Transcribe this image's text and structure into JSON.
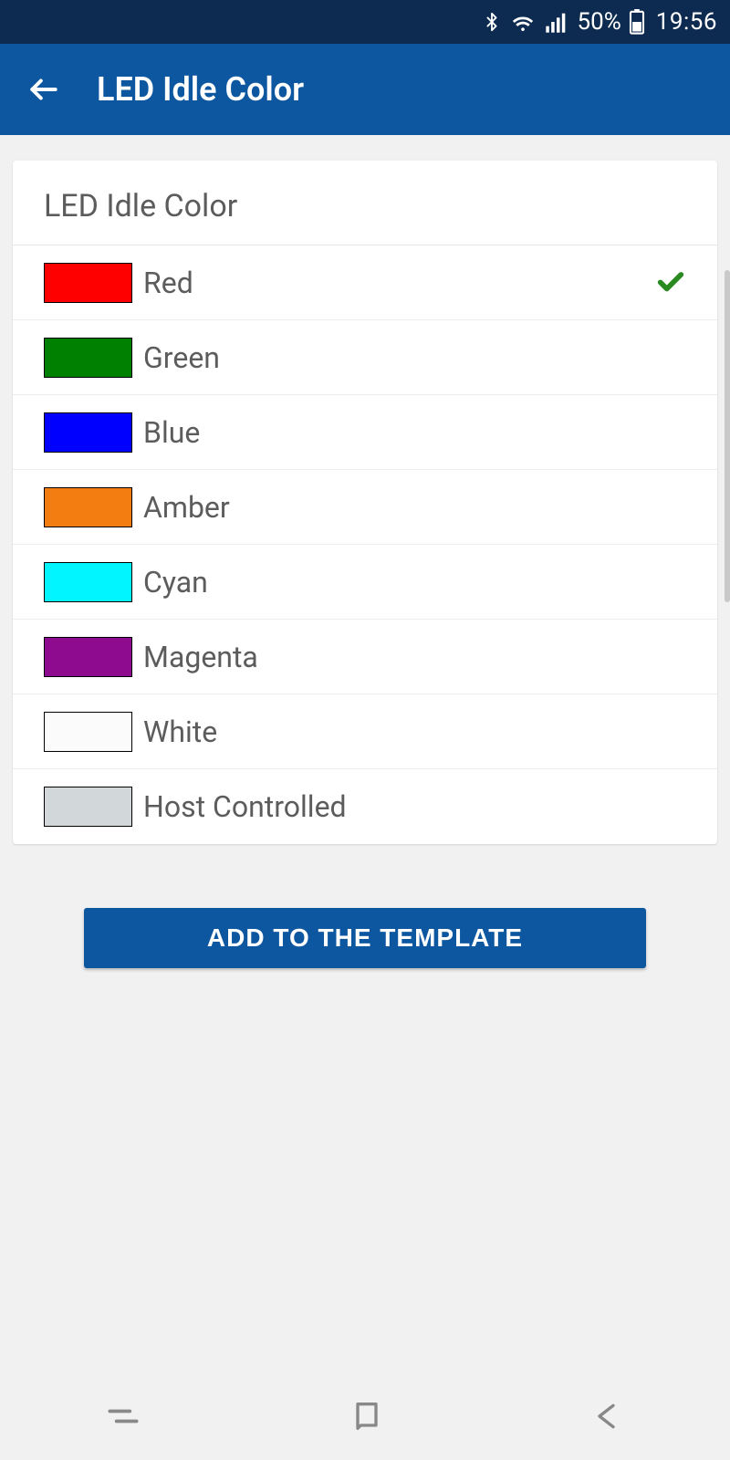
{
  "statusbar": {
    "battery_pct": "50%",
    "time": "19:56"
  },
  "appbar": {
    "title": "LED Idle Color"
  },
  "card": {
    "title": "LED Idle Color",
    "options": [
      {
        "label": "Red",
        "swatch": "#ff0000",
        "selected": true
      },
      {
        "label": "Green",
        "swatch": "#008000",
        "selected": false
      },
      {
        "label": "Blue",
        "swatch": "#0000ff",
        "selected": false
      },
      {
        "label": "Amber",
        "swatch": "#f37d11",
        "selected": false
      },
      {
        "label": "Cyan",
        "swatch": "#00f5ff",
        "selected": false
      },
      {
        "label": "Magenta",
        "swatch": "#8e0a8e",
        "selected": false
      },
      {
        "label": "White",
        "swatch": "#fbfbfb",
        "selected": false
      },
      {
        "label": "Host Controlled",
        "swatch": "#d2d8d9",
        "selected": false
      }
    ]
  },
  "buttons": {
    "add_template": "ADD TO THE TEMPLATE"
  }
}
